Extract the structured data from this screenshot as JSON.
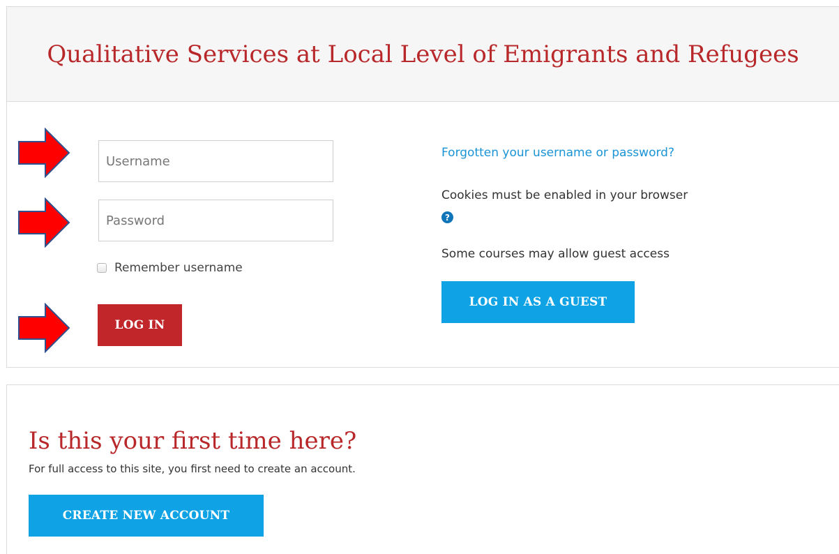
{
  "header": {
    "title": "Qualitative Services at Local Level of Emigrants and Refugees"
  },
  "login_form": {
    "username_placeholder": "Username",
    "password_placeholder": "Password",
    "remember_label": "Remember username",
    "login_button": "LOG IN"
  },
  "side_info": {
    "forgot_link": "Forgotten your username or password?",
    "cookies_text": "Cookies must be enabled in your browser",
    "help_icon_glyph": "?",
    "guest_text": "Some courses may allow guest access",
    "guest_button": "LOG IN AS A GUEST"
  },
  "signup": {
    "heading": "Is this your first time here?",
    "text": "For full access to this site, you first need to create an account.",
    "create_button": "CREATE NEW ACCOUNT"
  },
  "icons": {
    "arrow": "red-right-arrow-icon",
    "help": "question-circle-icon",
    "checkbox": "checkbox-unchecked"
  },
  "colors": {
    "brand_red": "#c0262a",
    "title_red": "#b8282a",
    "accent_blue": "#0fa3e6",
    "link_blue": "#1a94d6",
    "arrow_red": "#ff0000",
    "arrow_outline": "#2f528f"
  }
}
